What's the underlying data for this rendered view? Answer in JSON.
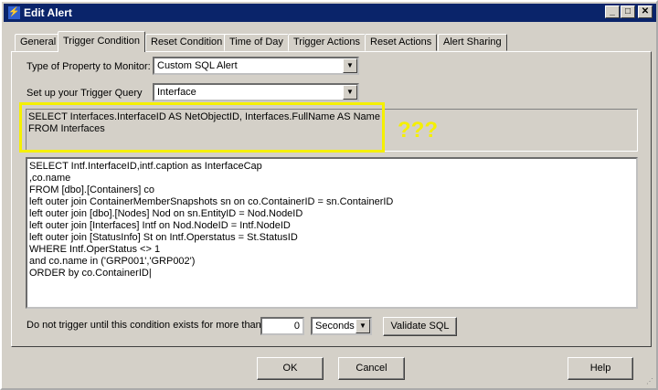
{
  "window": {
    "title": "Edit Alert",
    "icon": "alert-icon",
    "controls": [
      "minimize",
      "maximize",
      "close"
    ]
  },
  "tabs": [
    {
      "label": "General"
    },
    {
      "label": "Trigger Condition",
      "active": true
    },
    {
      "label": "Reset Condition"
    },
    {
      "label": "Time of Day"
    },
    {
      "label": "Trigger Actions"
    },
    {
      "label": "Reset Actions"
    },
    {
      "label": "Alert Sharing"
    }
  ],
  "form": {
    "property_label": "Type of Property to Monitor:",
    "property_value": "Custom SQL Alert",
    "query_label": "Set up your Trigger Query",
    "query_value": "Interface",
    "query_prefix": "SELECT Interfaces.InterfaceID AS NetObjectID, Interfaces.FullName AS Name\nFROM Interfaces",
    "annotation": "???",
    "sql_text": "SELECT Intf.InterfaceID,intf.caption as InterfaceCap\n,co.name\nFROM [dbo].[Containers] co\nleft outer join ContainerMemberSnapshots sn on co.ContainerID = sn.ContainerID\nleft outer join [dbo].[Nodes] Nod on sn.EntityID = Nod.NodeID\nleft outer join [Interfaces] Intf on Nod.NodeID = Intf.NodeID\nleft outer join [StatusInfo] St on Intf.Operstatus = St.StatusID\nWHERE Intf.OperStatus <> 1\nand co.name in ('GRP001','GRP002')\nORDER by co.ContainerID|",
    "delay_label": "Do not trigger until this condition exists for more than",
    "delay_value": "0",
    "delay_unit": "Seconds",
    "validate_label": "Validate SQL"
  },
  "buttons": {
    "ok": "OK",
    "cancel": "Cancel",
    "help": "Help"
  }
}
